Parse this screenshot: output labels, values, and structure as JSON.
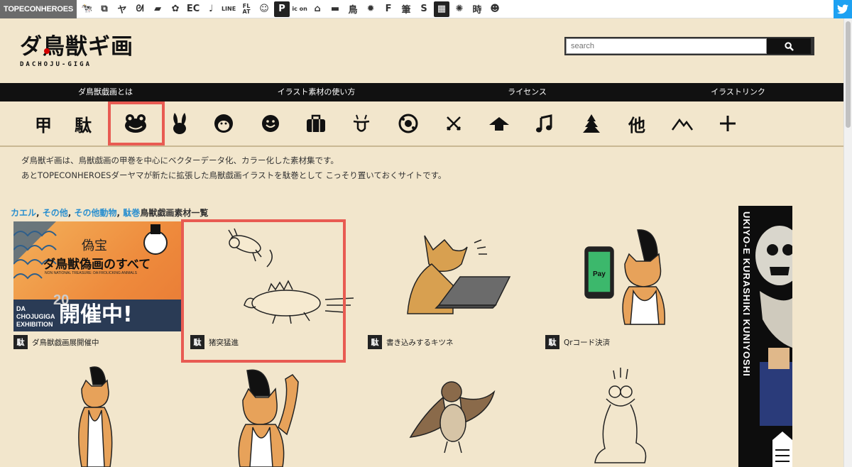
{
  "netbar": {
    "brand": "TOPECONHEROES",
    "items": [
      {
        "icon": "cow-icon",
        "text": "🐄"
      },
      {
        "icon": "copy-icon",
        "text": "⧉"
      },
      {
        "icon": "figure-icon",
        "text": "ヤ"
      },
      {
        "icon": "anteater-icon",
        "text": "ᘛ"
      },
      {
        "icon": "chat-icon",
        "text": "▰"
      },
      {
        "icon": "flower-icon",
        "text": "✿"
      },
      {
        "icon": "ec-icon",
        "text": "EC"
      },
      {
        "icon": "note-icon",
        "text": "♩"
      },
      {
        "icon": "line-icon",
        "text": "LINE"
      },
      {
        "icon": "flat-icon",
        "text": "FL AT"
      },
      {
        "icon": "smile-icon",
        "text": "☺"
      },
      {
        "icon": "p-icon",
        "text": "P"
      },
      {
        "icon": "icon-icon",
        "text": "ic on"
      },
      {
        "icon": "house-icon",
        "text": "⌂"
      },
      {
        "icon": "bed-icon",
        "text": "▬"
      },
      {
        "icon": "bird-icon",
        "text": "鳥"
      },
      {
        "icon": "gear-badge-icon",
        "text": "✹"
      },
      {
        "icon": "f-icon",
        "text": "F"
      },
      {
        "icon": "brush-icon",
        "text": "筆"
      },
      {
        "icon": "s-icon",
        "text": "S"
      },
      {
        "icon": "grid-icon",
        "text": "▦"
      },
      {
        "icon": "burst-icon",
        "text": "✺"
      },
      {
        "icon": "clock-kanji-icon",
        "text": "時"
      },
      {
        "icon": "face-icon",
        "text": "☻"
      }
    ]
  },
  "logo": {
    "title": "ダ鳥獣ギ画",
    "subtitle": "DACHOJU-GIGA"
  },
  "search": {
    "placeholder": "search"
  },
  "nav": [
    "ダ鳥獣戯画とは",
    "イラスト素材の使い方",
    "ライセンス",
    "イラストリンク"
  ],
  "categories": [
    {
      "name": "kou",
      "label": "甲",
      "icon": "kanji"
    },
    {
      "name": "da",
      "label": "駄",
      "icon": "kanji"
    },
    {
      "name": "frog",
      "label": "",
      "icon": "frog-icon"
    },
    {
      "name": "rabbit",
      "label": "",
      "icon": "rabbit-icon"
    },
    {
      "name": "monkey",
      "label": "",
      "icon": "monkey-icon"
    },
    {
      "name": "face",
      "label": "",
      "icon": "face-icon"
    },
    {
      "name": "bag",
      "label": "",
      "icon": "bag-icon"
    },
    {
      "name": "tongue",
      "label": "",
      "icon": "tongue-icon"
    },
    {
      "name": "ball",
      "label": "",
      "icon": "ball-icon"
    },
    {
      "name": "swords",
      "label": "",
      "icon": "swords-icon"
    },
    {
      "name": "house",
      "label": "",
      "icon": "roof-icon"
    },
    {
      "name": "music",
      "label": "",
      "icon": "music-note-icon"
    },
    {
      "name": "tree",
      "label": "",
      "icon": "tree-icon"
    },
    {
      "name": "other",
      "label": "他",
      "icon": "kanji"
    },
    {
      "name": "mountain",
      "label": "",
      "icon": "mountain-icon"
    },
    {
      "name": "plus",
      "label": "",
      "icon": "plus-icon"
    }
  ],
  "description": {
    "line1": "ダ鳥獣ギ画は、鳥獣戯画の甲巻を中心にベクターデータ化、カラー化した素材集です。",
    "line2": "あとTOPECONHEROESダーヤマが新たに拡張した鳥獣戯画イラストを駄巻として こっそり置いておくサイトです。"
  },
  "breadcrumb": {
    "links": [
      "カエル",
      "その他",
      "その他動物",
      "駄巻"
    ],
    "separator": ", ",
    "title": "鳥獣戯画素材一覧"
  },
  "cards": [
    {
      "badge": "駄",
      "title": "ダ鳥獣戯画展開催中",
      "thumb": "exhibition-banner"
    },
    {
      "badge": "駄",
      "title": "猪突猛進",
      "thumb": "boar-illustration"
    },
    {
      "badge": "駄",
      "title": "書き込みするキツネ",
      "thumb": "fox-laptop-illustration"
    },
    {
      "badge": "駄",
      "title": "Qrコード決済",
      "thumb": "cat-phone-illustration"
    }
  ],
  "exhibition": {
    "title": "ダ鳥獣偽画のすべて",
    "kanji": "偽宝",
    "sub": "ニセ国宝",
    "en": "NON NATIONAL TREASURE: DA FROLICKING ANIMALS",
    "status": "開催中!",
    "side": "DA CHOJUGIGA EXHIBITION",
    "year": "20"
  },
  "phone_label": "Pay",
  "banner": {
    "text": "UKIYO-E KURASHIKI KUNIYOSHI"
  },
  "colors": {
    "accent_link": "#2a8fcf",
    "highlight": "#e85b52",
    "bg": "#f2e6cc",
    "twitter": "#1da1f2"
  }
}
